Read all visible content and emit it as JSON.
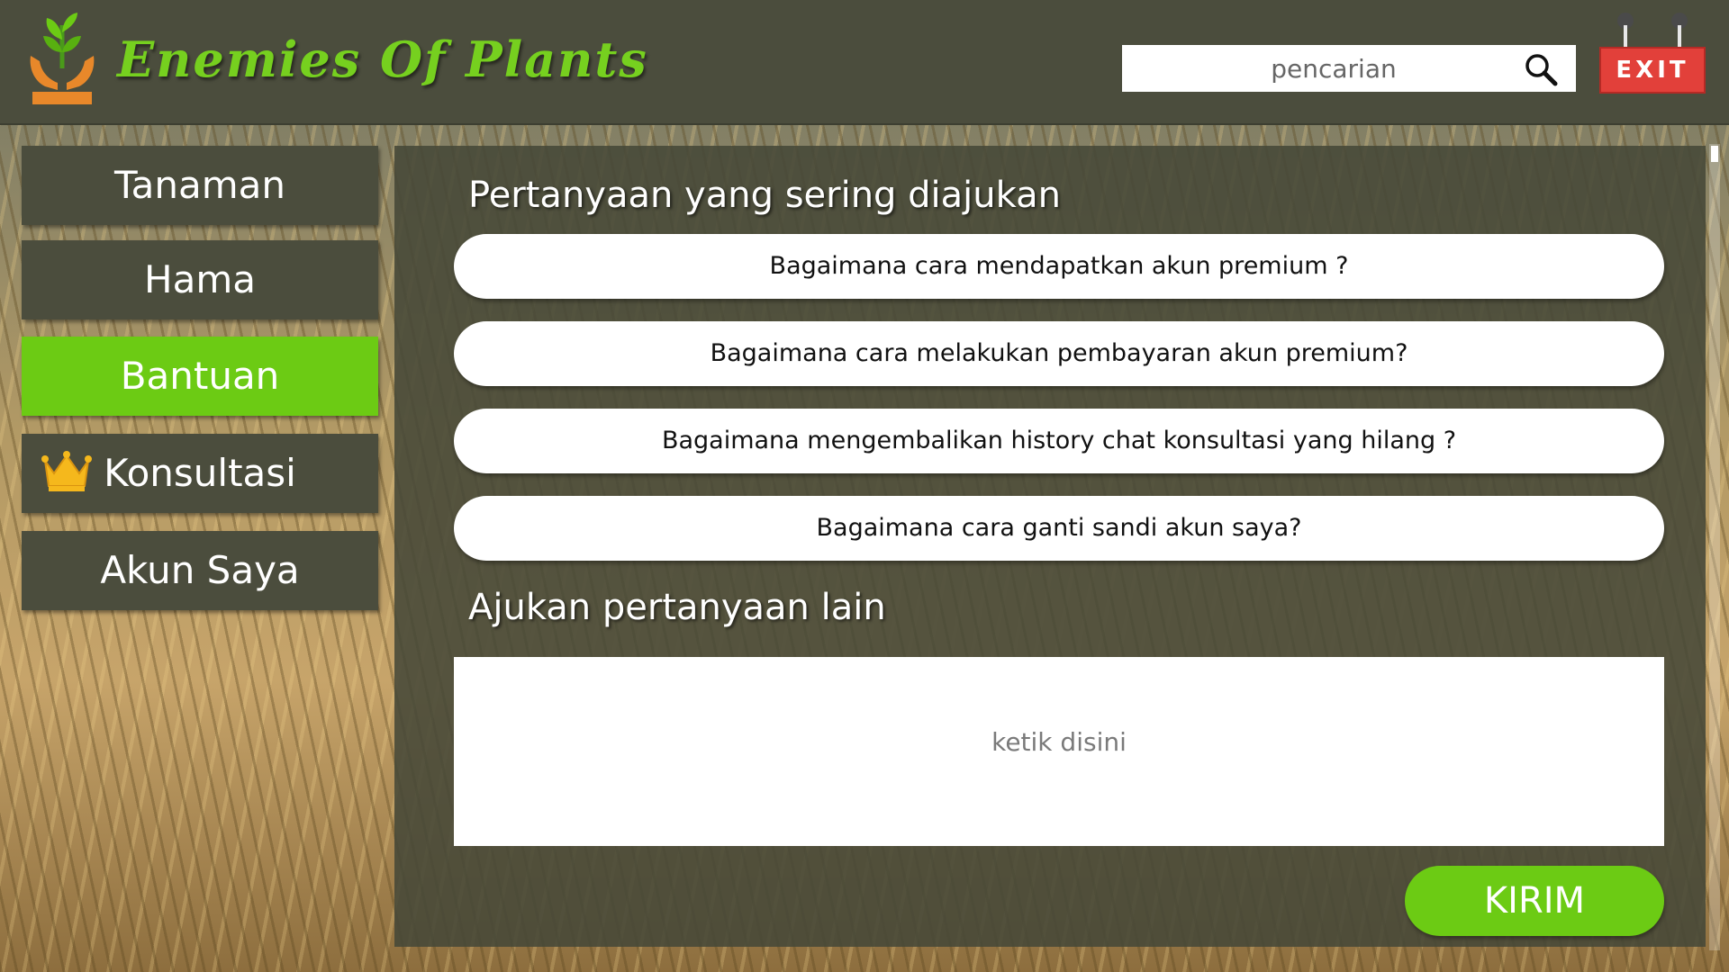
{
  "header": {
    "app_title": "Enemies Of Plants",
    "logo_icon": "plant-hands-icon",
    "search": {
      "placeholder": "pencarian",
      "value": "",
      "icon": "search-icon"
    },
    "exit_label": "EXIT"
  },
  "sidebar": {
    "items": [
      {
        "label": "Tanaman",
        "active": false
      },
      {
        "label": "Hama",
        "active": false
      },
      {
        "label": "Bantuan",
        "active": true
      },
      {
        "label": "Konsultasi",
        "active": false,
        "icon": "crown-icon"
      },
      {
        "label": "Akun Saya",
        "active": false
      }
    ]
  },
  "main": {
    "faq_title": "Pertanyaan yang sering diajukan",
    "faq": [
      "Bagaimana cara mendapatkan akun premium ?",
      "Bagaimana cara melakukan pembayaran akun premium?",
      "Bagaimana mengembalikan history chat konsultasi yang hilang ?",
      "Bagaimana cara ganti sandi akun saya?"
    ],
    "ask_title": "Ajukan pertanyaan lain",
    "ask_placeholder": "ketik disini",
    "send_label": "KIRIM"
  },
  "colors": {
    "header_bg": "#4b4d3d",
    "accent_green": "#6ccb14",
    "exit_red": "#e2403a",
    "panel_bg": "#464838"
  }
}
